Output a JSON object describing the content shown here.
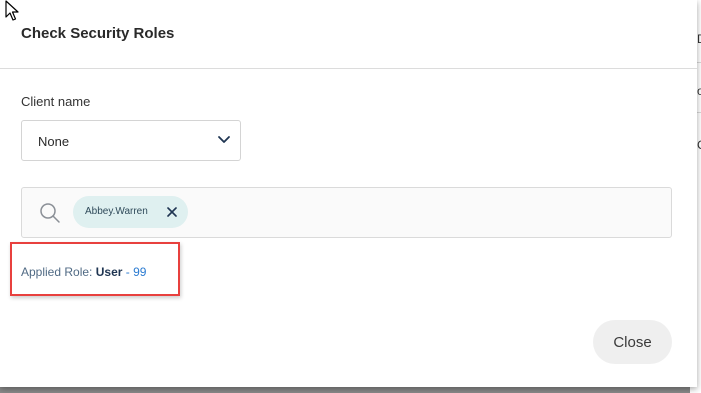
{
  "dialog": {
    "title": "Check Security Roles"
  },
  "client": {
    "label": "Client name",
    "selected": "None"
  },
  "search": {
    "chips": [
      {
        "label": "Abbey.Warren"
      }
    ]
  },
  "applied_role": {
    "label": "Applied Role:",
    "role": "User",
    "separator": " - ",
    "code": "99"
  },
  "footer": {
    "close_label": "Close"
  },
  "background_page": {
    "chars": [
      "D",
      "o",
      "C"
    ]
  },
  "colors": {
    "highlight": "#e8403e",
    "link_blue": "#2b7bd1",
    "chip_bg": "#dff0f0"
  }
}
